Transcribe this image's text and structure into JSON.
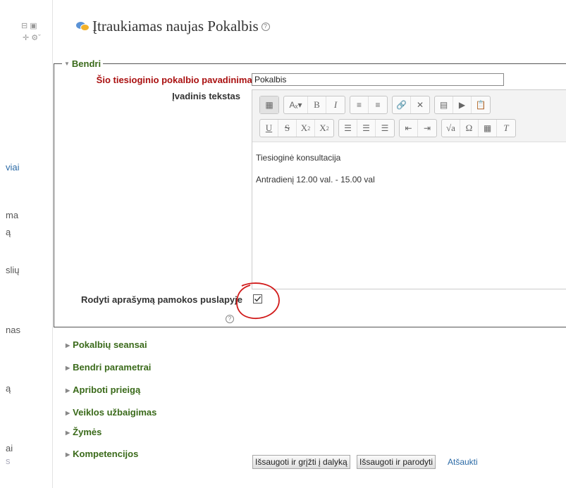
{
  "sidebar": {
    "fragments": [
      "viai",
      "ma",
      "ą",
      "slių",
      "nas",
      "ą",
      "ai",
      "s"
    ]
  },
  "header": {
    "title": "Įtraukiamas naujas Pokalbis",
    "help_icon": "help-icon"
  },
  "general": {
    "legend": "Bendri",
    "name_label": "Šio tiesioginio pokalbio pavadinimas",
    "required_mark": "*",
    "name_value": "Pokalbis",
    "intro_label": "Įvadinis tekstas",
    "intro_lines": [
      "Tiesioginė konsultacija",
      "Antradienį  12.00 val. - 15.00 val"
    ],
    "show_label": "Rodyti aprašymą pamokos puslapyje",
    "show_checked": true
  },
  "sections": [
    "Pokalbių seansai",
    "Bendri parametrai",
    "Apriboti prieigą",
    "Veiklos užbaigimas",
    "Žymės",
    "Kompetencijos"
  ],
  "buttons": {
    "save_return": "Išsaugoti ir grįžti į dalyką",
    "save_display": "Išsaugoti ir parodyti",
    "cancel": "Atšaukti"
  },
  "colors": {
    "required": "#aa1111",
    "section": "#3a6a1a",
    "link": "#2b6aa6",
    "annotation": "#d11a1a"
  }
}
